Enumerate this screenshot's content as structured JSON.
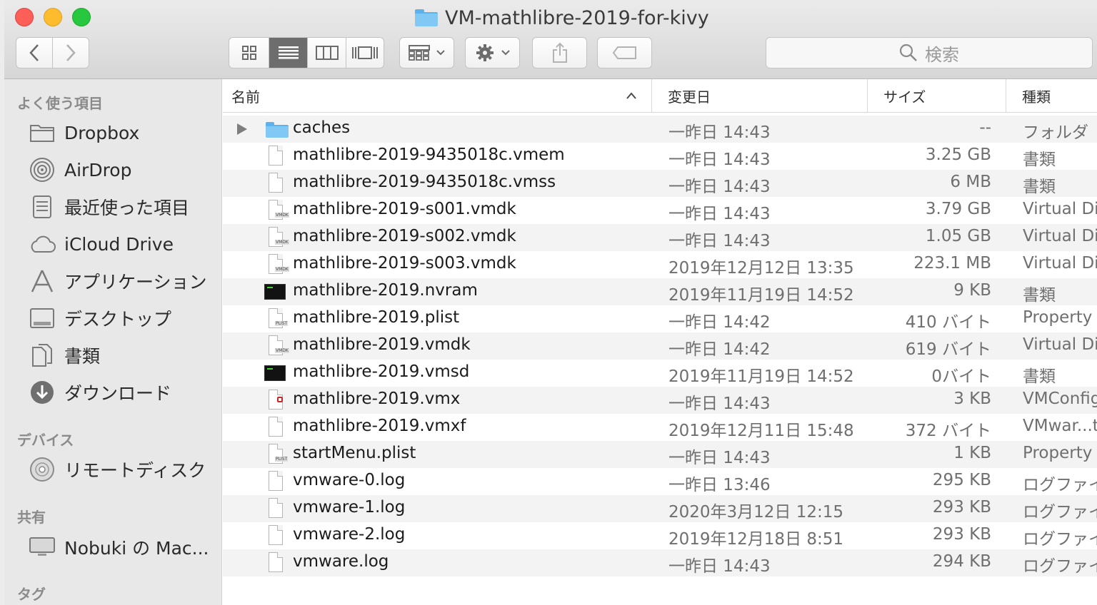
{
  "window": {
    "title": "VM-mathlibre-2019-for-kivy"
  },
  "toolbar": {
    "back_icon": "chevron-left-icon",
    "forward_icon": "chevron-right-icon",
    "view_modes": [
      "icon-view",
      "list-view",
      "column-view",
      "gallery-view"
    ],
    "active_view": "list-view",
    "search_placeholder": "検索"
  },
  "sidebar": {
    "favorites_header": "よく使う項目",
    "favorites": [
      {
        "label": "Dropbox",
        "icon": "folder-icon"
      },
      {
        "label": "AirDrop",
        "icon": "airdrop-icon"
      },
      {
        "label": "最近使った項目",
        "icon": "recents-icon"
      },
      {
        "label": "iCloud Drive",
        "icon": "cloud-icon"
      },
      {
        "label": "アプリケーション",
        "icon": "applications-icon"
      },
      {
        "label": "デスクトップ",
        "icon": "desktop-icon"
      },
      {
        "label": "書類",
        "icon": "documents-icon"
      },
      {
        "label": "ダウンロード",
        "icon": "downloads-icon"
      }
    ],
    "devices_header": "デバイス",
    "devices": [
      {
        "label": "リモートディスク",
        "icon": "disc-icon"
      }
    ],
    "shared_header": "共有",
    "shared": [
      {
        "label": "Nobuki の Mac...",
        "icon": "computer-icon"
      }
    ],
    "tags_header": "タグ"
  },
  "columns": {
    "name": "名前",
    "date": "変更日",
    "size": "サイズ",
    "kind": "種類"
  },
  "files": [
    {
      "name": "caches",
      "date": "一昨日 14:43",
      "size": "--",
      "kind": "フォルダ",
      "type": "folder"
    },
    {
      "name": "mathlibre-2019-9435018c.vmem",
      "date": "一昨日 14:43",
      "size": "3.25 GB",
      "kind": "書類",
      "type": "doc"
    },
    {
      "name": "mathlibre-2019-9435018c.vmss",
      "date": "一昨日 14:43",
      "size": "6 MB",
      "kind": "書類",
      "type": "doc"
    },
    {
      "name": "mathlibre-2019-s001.vmdk",
      "date": "一昨日 14:43",
      "size": "3.79 GB",
      "kind": "Virtual Dis",
      "type": "vmdk"
    },
    {
      "name": "mathlibre-2019-s002.vmdk",
      "date": "一昨日 14:43",
      "size": "1.05 GB",
      "kind": "Virtual Dis",
      "type": "vmdk"
    },
    {
      "name": "mathlibre-2019-s003.vmdk",
      "date": "2019年12月12日 13:35",
      "size": "223.1 MB",
      "kind": "Virtual Dis",
      "type": "vmdk"
    },
    {
      "name": "mathlibre-2019.nvram",
      "date": "2019年11月19日 14:52",
      "size": "9 KB",
      "kind": "書類",
      "type": "terminal"
    },
    {
      "name": "mathlibre-2019.plist",
      "date": "一昨日 14:42",
      "size": "410 バイト",
      "kind": "Property L",
      "type": "plist"
    },
    {
      "name": "mathlibre-2019.vmdk",
      "date": "一昨日 14:42",
      "size": "619 バイト",
      "kind": "Virtual Dis",
      "type": "vmdk"
    },
    {
      "name": "mathlibre-2019.vmsd",
      "date": "2019年11月19日 14:52",
      "size": "0バイト",
      "kind": "書類",
      "type": "terminal"
    },
    {
      "name": "mathlibre-2019.vmx",
      "date": "一昨日 14:43",
      "size": "3 KB",
      "kind": "VMConfig",
      "type": "vmx"
    },
    {
      "name": "mathlibre-2019.vmxf",
      "date": "2019年12月11日 15:48",
      "size": "372 バイト",
      "kind": "VMwar...ta",
      "type": "doc"
    },
    {
      "name": "startMenu.plist",
      "date": "一昨日 14:43",
      "size": "1 KB",
      "kind": "Property L",
      "type": "plist"
    },
    {
      "name": "vmware-0.log",
      "date": "一昨日 13:46",
      "size": "295 KB",
      "kind": "ログファイ",
      "type": "doc"
    },
    {
      "name": "vmware-1.log",
      "date": "2020年3月12日 12:15",
      "size": "293 KB",
      "kind": "ログファイ",
      "type": "doc"
    },
    {
      "name": "vmware-2.log",
      "date": "2019年12月18日 8:51",
      "size": "293 KB",
      "kind": "ログファイ",
      "type": "doc"
    },
    {
      "name": "vmware.log",
      "date": "一昨日 14:43",
      "size": "294 KB",
      "kind": "ログファイ",
      "type": "doc"
    }
  ]
}
